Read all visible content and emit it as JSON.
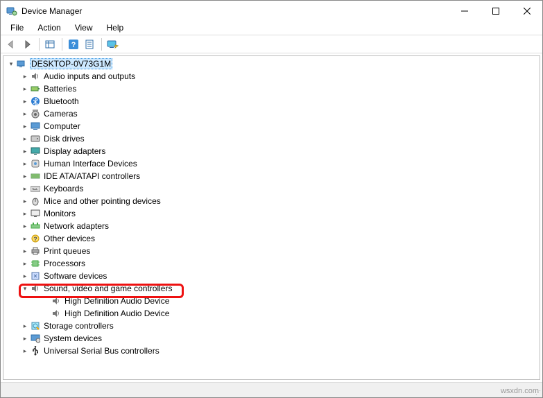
{
  "title": "Device Manager",
  "menu": [
    "File",
    "Action",
    "View",
    "Help"
  ],
  "toolbar": {
    "back": "back-icon",
    "forward": "forward-icon",
    "show_hidden": "show-hidden-icon",
    "help": "help-icon",
    "properties": "properties-icon",
    "monitor": "monitor-icon"
  },
  "root": {
    "label": "DESKTOP-0V73G1M",
    "expanded": true
  },
  "categories": [
    {
      "label": "Audio inputs and outputs",
      "icon": "speaker-icon",
      "expanded": false
    },
    {
      "label": "Batteries",
      "icon": "battery-icon",
      "expanded": false
    },
    {
      "label": "Bluetooth",
      "icon": "bluetooth-icon",
      "expanded": false
    },
    {
      "label": "Cameras",
      "icon": "camera-icon",
      "expanded": false
    },
    {
      "label": "Computer",
      "icon": "computer-icon",
      "expanded": false
    },
    {
      "label": "Disk drives",
      "icon": "disk-icon",
      "expanded": false
    },
    {
      "label": "Display adapters",
      "icon": "display-icon",
      "expanded": false
    },
    {
      "label": "Human Interface Devices",
      "icon": "hid-icon",
      "expanded": false
    },
    {
      "label": "IDE ATA/ATAPI controllers",
      "icon": "ide-icon",
      "expanded": false
    },
    {
      "label": "Keyboards",
      "icon": "keyboard-icon",
      "expanded": false
    },
    {
      "label": "Mice and other pointing devices",
      "icon": "mouse-icon",
      "expanded": false
    },
    {
      "label": "Monitors",
      "icon": "monitor-device-icon",
      "expanded": false
    },
    {
      "label": "Network adapters",
      "icon": "network-icon",
      "expanded": false
    },
    {
      "label": "Other devices",
      "icon": "other-icon",
      "expanded": false
    },
    {
      "label": "Print queues",
      "icon": "printer-icon",
      "expanded": false
    },
    {
      "label": "Processors",
      "icon": "cpu-icon",
      "expanded": false
    },
    {
      "label": "Software devices",
      "icon": "software-icon",
      "expanded": false
    },
    {
      "label": "Sound, video and game controllers",
      "icon": "sound-icon",
      "expanded": true,
      "children": [
        {
          "label": "High Definition Audio Device",
          "icon": "sound-icon"
        },
        {
          "label": "High Definition Audio Device",
          "icon": "sound-icon"
        }
      ]
    },
    {
      "label": "Storage controllers",
      "icon": "storage-icon",
      "expanded": false
    },
    {
      "label": "System devices",
      "icon": "system-icon",
      "expanded": false
    },
    {
      "label": "Universal Serial Bus controllers",
      "icon": "usb-icon",
      "expanded": false
    }
  ],
  "watermark": "wsxdn.com",
  "highlighted_index": 17
}
